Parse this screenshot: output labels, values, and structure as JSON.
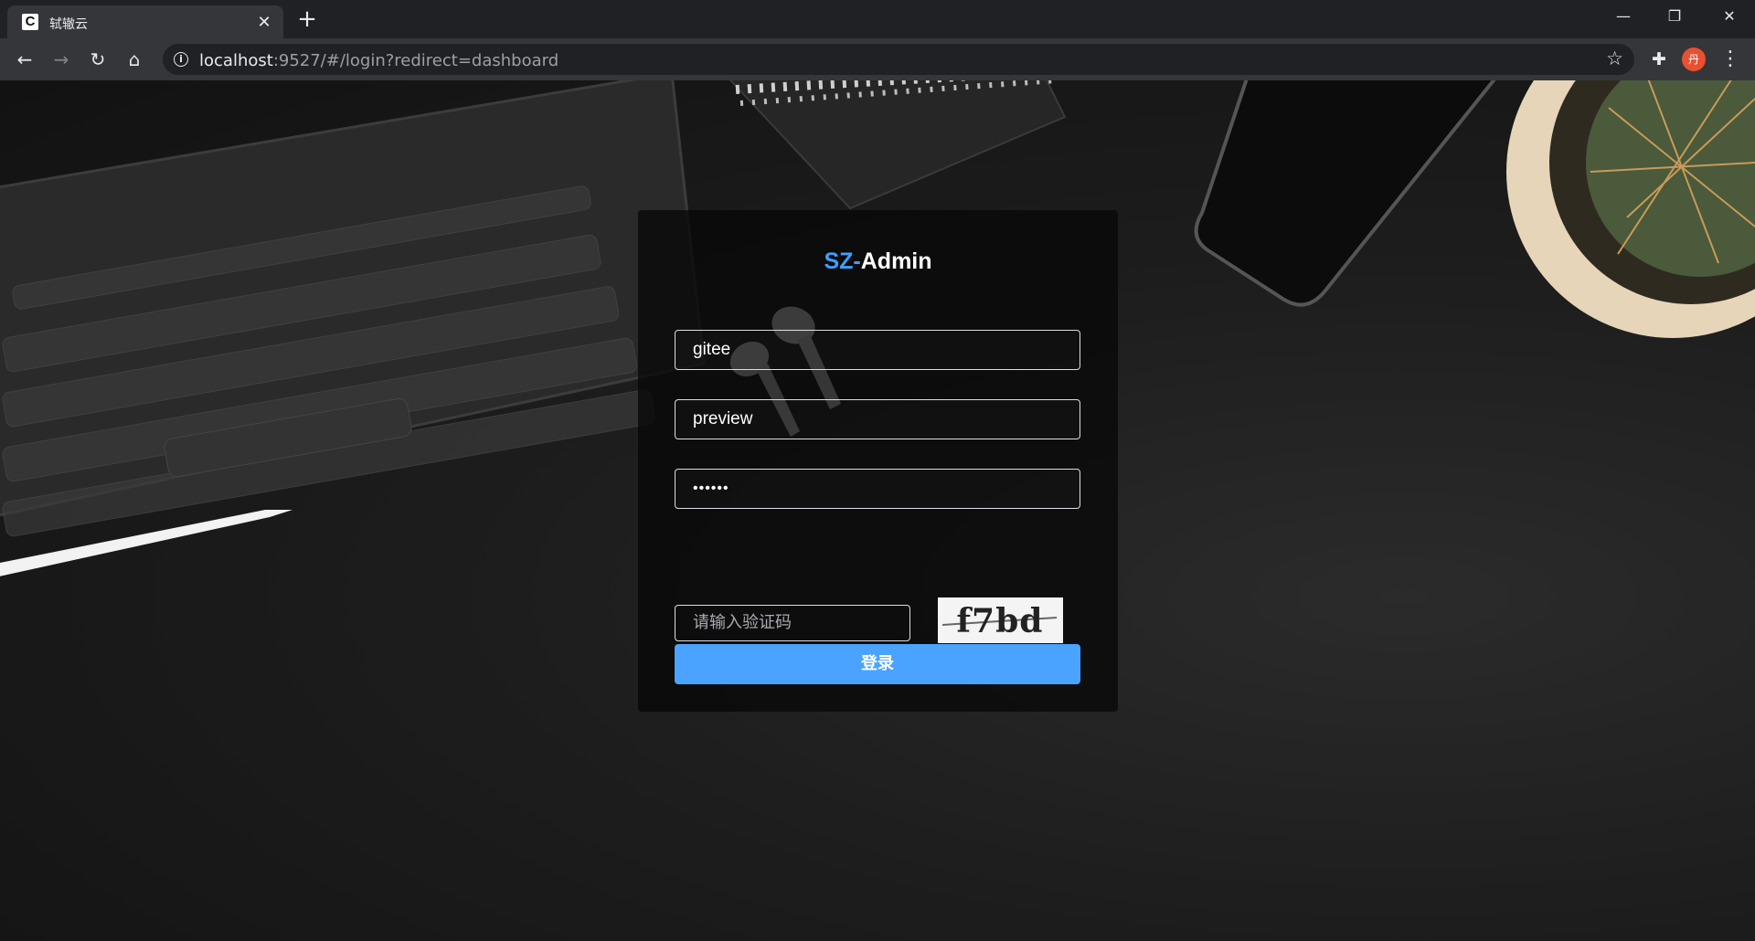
{
  "browser": {
    "tab_title": "轼辙云",
    "tab_favicon_letter": "C",
    "new_tab_symbol": "+",
    "url_host": "localhost",
    "url_rest": ":9527/#/login?redirect=dashboard",
    "profile_initial": "丹"
  },
  "login": {
    "title_prefix": "SZ-",
    "title_suffix": "Admin",
    "tenant_value": "gitee",
    "username_value": "preview",
    "password_mask": "••••••",
    "captcha_placeholder": "请输入验证码",
    "captcha_text": "f7bd",
    "login_button": "登录",
    "accent_color": "#409eff",
    "button_color": "#4aa3ff"
  }
}
